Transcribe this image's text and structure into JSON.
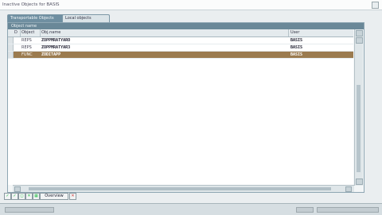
{
  "window": {
    "title": "Inactive Objects for BASIS"
  },
  "tabs": [
    {
      "label": "Transportable Objects"
    },
    {
      "label": "Local objects"
    }
  ],
  "grid": {
    "header": "Object name",
    "columns": {
      "sel": "D",
      "object": "Object",
      "name": "Obj.name",
      "user": "User"
    },
    "rows": [
      {
        "object": "REPS",
        "name": "ZOPPMRATYARO",
        "user": "BASIS",
        "selected": false
      },
      {
        "object": "REPS",
        "name": "ZOPPMRATYAR3",
        "user": "BASIS",
        "selected": false
      },
      {
        "object": "FUNC",
        "name": "ZODITAPP",
        "user": "BASIS",
        "selected": true
      }
    ]
  },
  "toolbar": {
    "overview_label": "Overview"
  }
}
